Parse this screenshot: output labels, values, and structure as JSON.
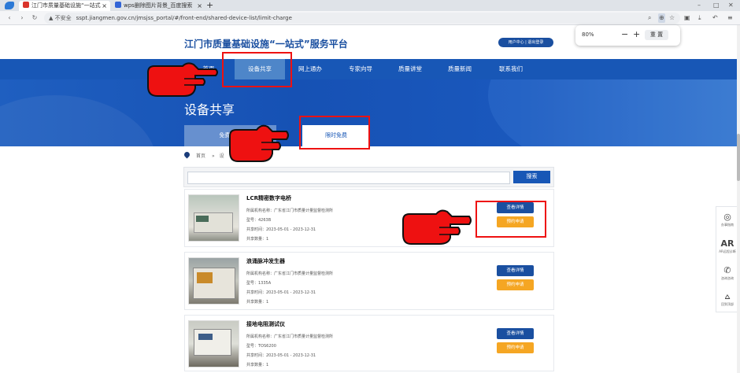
{
  "browser": {
    "tabs": [
      {
        "title": "江门市质量基础设施“一站式”服",
        "active": true
      },
      {
        "title": "wps删除图片背景_百度搜索",
        "active": false
      }
    ],
    "close_glyph": "×",
    "new_tab_glyph": "+",
    "window_controls": {
      "minimize": "–",
      "restore": "□",
      "close": "✕"
    },
    "nav": {
      "back": "‹",
      "forward": "›",
      "reload": "↻"
    },
    "security_label": "▲ 不安全",
    "url": "sspt.jiangmen.gov.cn/jmsjss_portal/#/front-end/shared-device-list/limit-charge",
    "zoom_popup": {
      "percent": "80%",
      "minus": "−",
      "plus": "+",
      "reset": "重 置"
    }
  },
  "header": {
    "site_title": "江门市质量基础设施“一站式”服务平台",
    "user_buttons": "用户中心 | 退出登录"
  },
  "navbar": {
    "items": [
      "首页",
      "设备共享",
      "网上通办",
      "专家向导",
      "质量讲堂",
      "质量新闻",
      "联系我们"
    ],
    "active_index": 1
  },
  "banner": {
    "title": "设备共享",
    "tabs": [
      "免费共享",
      "限时免费"
    ],
    "active_tab": 1
  },
  "breadcrumb": {
    "home": "首页",
    "sep": "»",
    "current": "设"
  },
  "search": {
    "placeholder": "",
    "button": "搜索"
  },
  "devices": [
    {
      "name": "LCR精密数字电桥",
      "org": "所属机构名称：广东省江门市质量计量监督检测所",
      "model": "型号：4263B",
      "share_time": "共享时间：2023-05-01 - 2023-12-31",
      "count": "共享数量：1",
      "detail_btn": "查看详情",
      "apply_btn": "预约申请"
    },
    {
      "name": "浪涌脉冲发生器",
      "org": "所属机构名称：广东省江门市质量计量监督检测所",
      "model": "型号：1335A",
      "share_time": "共享时间：2023-05-01 - 2023-12-31",
      "count": "共享数量：1",
      "detail_btn": "查看详情",
      "apply_btn": "预约申请"
    },
    {
      "name": "接地电阻测试仪",
      "org": "所属机构名称：广东省江门市质量计量监督检测所",
      "model": "型号：TOS6200",
      "share_time": "共享时间：2023-05-01 - 2023-12-31",
      "count": "共享数量：1",
      "detail_btn": "查看详情",
      "apply_btn": "预约申请"
    }
  ],
  "side_panel": [
    {
      "icon": "compass-icon",
      "label": "办事指南"
    },
    {
      "icon": "ar-icon",
      "label": "AR远程诊断"
    },
    {
      "icon": "phone-icon",
      "label": "咨询咨询"
    },
    {
      "icon": "top-icon",
      "label": "回到顶部"
    }
  ],
  "colors": {
    "brand_blue": "#1857b6",
    "apply_orange": "#f5a623",
    "annotation_red": "#ee1111"
  }
}
